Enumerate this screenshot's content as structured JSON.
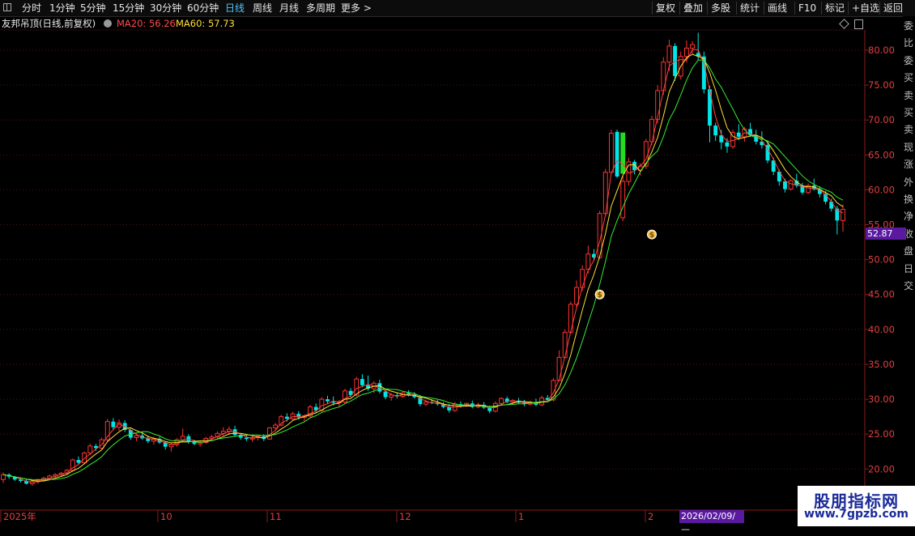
{
  "toolbar": {
    "left": [
      "分时",
      "1分钟",
      "5分钟",
      "15分钟",
      "30分钟",
      "60分钟",
      "日线",
      "周线",
      "月线",
      "多周期",
      "更多 >"
    ],
    "active": "日线",
    "right": [
      "复权",
      "叠加",
      "多股",
      "统计",
      "画线",
      "F10",
      "标记",
      "+自选",
      "返回"
    ]
  },
  "legend": {
    "stock_name": "友邦吊顶(日线,前复权)",
    "ma20": "MA20: 56.26",
    "ma60": "MA60: 57.73"
  },
  "colors": {
    "up": "#ff3232",
    "down": "#00e6e6",
    "ma20": "#ff4040",
    "ma_mid": "#ffe033",
    "ma60": "#33ee33",
    "axis": "#8b1c1c",
    "highlight": "#5a1aa0"
  },
  "right_strip_text": [
    "委",
    "比",
    "委",
    "买",
    "卖",
    "买",
    "卖",
    "现",
    "涨",
    "外",
    "换",
    "净",
    "收",
    "盘",
    "日",
    "交"
  ],
  "price_tag": "52.87",
  "date_tag": "2026/02/09/—",
  "watermark": {
    "title": "股朋指标网",
    "url": "www.7gpzb.com"
  },
  "chart_data": {
    "type": "candlestick",
    "y_axis": {
      "ticks": [
        "80.00",
        "75.00",
        "70.00",
        "65.00",
        "60.00",
        "55.00",
        "50.00",
        "45.00",
        "40.00",
        "35.00",
        "30.00",
        "25.00",
        "20.00"
      ],
      "tick_values": [
        80,
        75,
        70,
        65,
        60,
        55,
        50,
        45,
        40,
        35,
        30,
        25,
        20
      ],
      "top_segment": [
        40,
        80
      ],
      "bottom_segment": [
        20,
        35
      ]
    },
    "x_axis_labels": [
      "2025年",
      "10",
      "11",
      "12",
      "1",
      "2"
    ],
    "candles": [
      [
        18.5,
        19.5,
        18.0,
        19.2
      ],
      [
        19.2,
        19.4,
        18.6,
        18.9
      ],
      [
        18.9,
        19.0,
        18.3,
        18.5
      ],
      [
        18.5,
        18.8,
        18.1,
        18.3
      ],
      [
        18.3,
        18.6,
        17.8,
        17.9
      ],
      [
        17.9,
        18.4,
        17.6,
        18.2
      ],
      [
        18.2,
        18.6,
        17.9,
        18.4
      ],
      [
        18.4,
        18.9,
        18.2,
        18.7
      ],
      [
        18.7,
        19.2,
        18.5,
        19.0
      ],
      [
        19.0,
        19.4,
        18.7,
        19.2
      ],
      [
        19.2,
        19.6,
        18.9,
        19.4
      ],
      [
        19.4,
        20.0,
        19.2,
        19.8
      ],
      [
        19.8,
        21.5,
        19.6,
        21.3
      ],
      [
        21.3,
        21.8,
        20.6,
        20.9
      ],
      [
        20.9,
        22.5,
        20.8,
        22.3
      ],
      [
        22.3,
        23.6,
        22.0,
        23.3
      ],
      [
        23.3,
        23.6,
        22.6,
        23.0
      ],
      [
        23.0,
        24.5,
        22.8,
        24.2
      ],
      [
        24.2,
        27.2,
        24.0,
        26.8
      ],
      [
        26.8,
        27.3,
        25.6,
        26.0
      ],
      [
        26.0,
        27.1,
        25.5,
        26.6
      ],
      [
        26.6,
        27.0,
        25.3,
        25.6
      ],
      [
        25.6,
        25.8,
        24.2,
        24.5
      ],
      [
        24.5,
        25.1,
        24.0,
        24.8
      ],
      [
        24.8,
        25.2,
        24.2,
        24.4
      ],
      [
        24.4,
        24.8,
        23.7,
        24.0
      ],
      [
        24.0,
        24.6,
        23.5,
        24.3
      ],
      [
        24.3,
        24.6,
        23.6,
        23.8
      ],
      [
        23.8,
        24.0,
        22.8,
        23.2
      ],
      [
        23.2,
        23.8,
        22.5,
        23.5
      ],
      [
        23.5,
        24.4,
        23.2,
        24.2
      ],
      [
        24.2,
        25.8,
        24.0,
        24.7
      ],
      [
        24.7,
        25.0,
        23.6,
        23.9
      ],
      [
        23.9,
        24.2,
        23.4,
        23.6
      ],
      [
        23.6,
        24.0,
        23.2,
        23.8
      ],
      [
        23.8,
        24.6,
        23.6,
        24.4
      ],
      [
        24.4,
        24.9,
        24.0,
        24.6
      ],
      [
        24.6,
        25.4,
        24.3,
        25.1
      ],
      [
        25.1,
        26.0,
        24.8,
        25.4
      ],
      [
        25.4,
        26.1,
        24.9,
        25.7
      ],
      [
        25.7,
        26.2,
        24.6,
        24.9
      ],
      [
        24.9,
        25.1,
        24.2,
        24.5
      ],
      [
        24.5,
        24.8,
        24.0,
        24.3
      ],
      [
        24.3,
        24.7,
        23.9,
        24.5
      ],
      [
        24.5,
        24.9,
        24.1,
        24.7
      ],
      [
        24.7,
        25.0,
        24.0,
        24.3
      ],
      [
        24.3,
        26.0,
        24.2,
        25.9
      ],
      [
        25.9,
        26.6,
        25.5,
        26.3
      ],
      [
        26.3,
        27.8,
        26.1,
        27.5
      ],
      [
        27.5,
        28.0,
        26.8,
        27.2
      ],
      [
        27.2,
        28.2,
        27.0,
        27.9
      ],
      [
        27.9,
        28.3,
        27.1,
        27.4
      ],
      [
        27.4,
        27.8,
        26.9,
        27.6
      ],
      [
        27.6,
        29.2,
        27.4,
        28.9
      ],
      [
        28.9,
        29.4,
        28.1,
        28.4
      ],
      [
        28.4,
        30.3,
        28.2,
        30.0
      ],
      [
        30.0,
        30.5,
        29.3,
        29.7
      ],
      [
        29.7,
        30.4,
        29.1,
        29.5
      ],
      [
        29.5,
        29.9,
        28.9,
        29.6
      ],
      [
        29.6,
        31.5,
        29.4,
        31.2
      ],
      [
        31.2,
        31.6,
        30.3,
        30.6
      ],
      [
        30.6,
        33.2,
        30.4,
        32.9
      ],
      [
        32.9,
        33.6,
        31.7,
        32.0
      ],
      [
        32.0,
        33.4,
        31.2,
        31.5
      ],
      [
        31.5,
        32.6,
        30.9,
        32.3
      ],
      [
        32.3,
        32.8,
        30.8,
        31.1
      ],
      [
        31.1,
        31.4,
        30.0,
        30.3
      ],
      [
        30.3,
        30.9,
        29.8,
        30.6
      ],
      [
        30.6,
        31.0,
        30.1,
        30.4
      ],
      [
        30.4,
        31.1,
        30.2,
        30.9
      ],
      [
        30.9,
        31.3,
        30.4,
        30.7
      ],
      [
        30.7,
        31.0,
        30.1,
        30.3
      ],
      [
        30.3,
        30.6,
        29.0,
        29.3
      ],
      [
        29.3,
        29.9,
        29.0,
        29.6
      ],
      [
        29.6,
        30.0,
        29.3,
        29.5
      ],
      [
        29.5,
        29.9,
        29.1,
        29.3
      ],
      [
        29.3,
        29.6,
        28.7,
        28.9
      ],
      [
        28.9,
        29.3,
        28.1,
        28.4
      ],
      [
        28.4,
        29.6,
        28.2,
        29.3
      ],
      [
        29.3,
        29.7,
        28.8,
        29.1
      ],
      [
        29.1,
        29.5,
        28.9,
        29.4
      ],
      [
        29.4,
        29.8,
        28.7,
        28.9
      ],
      [
        28.9,
        29.5,
        28.7,
        29.2
      ],
      [
        29.2,
        29.6,
        28.6,
        28.8
      ],
      [
        28.8,
        29.1,
        28.0,
        28.3
      ],
      [
        28.3,
        29.7,
        28.1,
        29.4
      ],
      [
        29.4,
        30.3,
        29.2,
        30.1
      ],
      [
        30.1,
        30.4,
        29.4,
        29.6
      ],
      [
        29.6,
        30.0,
        29.2,
        29.8
      ],
      [
        29.8,
        30.2,
        29.4,
        29.5
      ],
      [
        29.5,
        29.9,
        29.0,
        29.3
      ],
      [
        29.3,
        29.8,
        29.1,
        29.6
      ],
      [
        29.6,
        30.1,
        29.0,
        29.2
      ],
      [
        29.2,
        30.5,
        29.0,
        30.2
      ],
      [
        30.2,
        30.6,
        29.6,
        29.9
      ],
      [
        29.9,
        33.0,
        29.7,
        32.7
      ],
      [
        32.7,
        37.0,
        32.6,
        36.0
      ],
      [
        36.0,
        40.0,
        35.8,
        39.6
      ],
      [
        39.6,
        44.0,
        39.4,
        43.6
      ],
      [
        43.6,
        47.0,
        43.0,
        46.0
      ],
      [
        46.0,
        49.2,
        45.5,
        48.6
      ],
      [
        48.6,
        52.0,
        48.0,
        50.8
      ],
      [
        50.8,
        51.5,
        50.0,
        50.3
      ],
      [
        50.3,
        57.0,
        50.1,
        56.6
      ],
      [
        56.6,
        63.0,
        56.2,
        62.5
      ],
      [
        62.5,
        68.6,
        62.3,
        68.1
      ],
      [
        68.3,
        68.6,
        61.7,
        61.9
      ],
      [
        56.0,
        62.0,
        55.5,
        61.2
      ],
      [
        61.2,
        64.6,
        60.6,
        64.0
      ],
      [
        64.0,
        64.3,
        62.2,
        62.8
      ],
      [
        62.8,
        63.8,
        62.0,
        63.4
      ],
      [
        63.4,
        67.3,
        63.0,
        66.9
      ],
      [
        66.9,
        70.6,
        66.4,
        70.1
      ],
      [
        70.1,
        75.0,
        69.5,
        74.2
      ],
      [
        74.2,
        79.0,
        73.6,
        78.3
      ],
      [
        78.3,
        81.5,
        77.0,
        80.6
      ],
      [
        80.6,
        81.0,
        75.6,
        76.3
      ],
      [
        76.3,
        79.8,
        75.8,
        79.1
      ],
      [
        79.1,
        81.4,
        78.2,
        80.3
      ],
      [
        80.3,
        81.3,
        79.4,
        80.8
      ],
      [
        79.6,
        82.5,
        78.6,
        79.1
      ],
      [
        79.1,
        79.8,
        73.8,
        74.4
      ],
      [
        74.4,
        74.9,
        66.8,
        69.2
      ],
      [
        69.2,
        69.6,
        67.0,
        67.8
      ],
      [
        67.8,
        68.6,
        65.8,
        66.8
      ],
      [
        66.8,
        67.4,
        65.3,
        66.2
      ],
      [
        66.2,
        68.6,
        65.9,
        68.2
      ],
      [
        68.2,
        69.4,
        67.1,
        67.6
      ],
      [
        67.6,
        69.0,
        66.9,
        68.7
      ],
      [
        68.7,
        69.6,
        67.6,
        67.8
      ],
      [
        67.8,
        68.6,
        66.5,
        66.9
      ],
      [
        66.9,
        68.4,
        65.9,
        66.4
      ],
      [
        66.4,
        67.0,
        63.8,
        64.2
      ],
      [
        64.2,
        64.6,
        62.1,
        62.6
      ],
      [
        62.6,
        62.9,
        60.6,
        61.2
      ],
      [
        61.2,
        61.6,
        59.6,
        60.1
      ],
      [
        60.1,
        61.5,
        59.9,
        61.3
      ],
      [
        61.3,
        62.3,
        60.3,
        60.6
      ],
      [
        60.6,
        61.0,
        59.3,
        59.6
      ],
      [
        59.6,
        60.9,
        59.4,
        60.6
      ],
      [
        60.6,
        61.6,
        59.9,
        60.1
      ],
      [
        60.1,
        60.5,
        58.9,
        59.4
      ],
      [
        59.4,
        59.8,
        57.9,
        58.3
      ],
      [
        58.3,
        58.7,
        56.9,
        57.3
      ],
      [
        57.3,
        57.7,
        53.6,
        55.6
      ],
      [
        55.6,
        57.9,
        54.0,
        57.2
      ]
    ],
    "series": [
      {
        "name": "MA20"
      },
      {
        "name": "MA60"
      }
    ],
    "markers": [
      {
        "index": 103,
        "price": 45.0,
        "symbol": "$"
      },
      {
        "index": 112,
        "price": 53.6,
        "symbol": "$"
      }
    ]
  }
}
